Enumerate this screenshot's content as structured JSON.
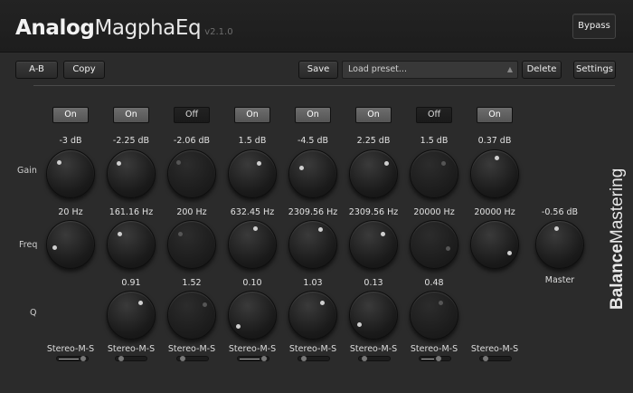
{
  "app": {
    "title_bold": "Analog",
    "title_light": "MagphaEq",
    "version": "v2.1.0",
    "bypass_label": "Bypass"
  },
  "toolbar": {
    "ab_label": "A-B",
    "copy_label": "Copy",
    "save_label": "Save",
    "preset_placeholder": "Load preset...",
    "delete_label": "Delete",
    "settings_label": "Settings"
  },
  "row_labels": {
    "gain": "Gain",
    "freq": "Freq",
    "q": "Q"
  },
  "bands": [
    {
      "state": "On",
      "gain": "-3 dB",
      "freq": "20 Hz",
      "q": "",
      "mode": "Stereo-M-S"
    },
    {
      "state": "On",
      "gain": "-2.25 dB",
      "freq": "161.16 Hz",
      "q": "0.91",
      "mode": "Stereo-M-S"
    },
    {
      "state": "Off",
      "gain": "-2.06 dB",
      "freq": "200 Hz",
      "q": "1.52",
      "mode": "Stereo-M-S"
    },
    {
      "state": "On",
      "gain": "1.5 dB",
      "freq": "632.45 Hz",
      "q": "0.10",
      "mode": "Stereo-M-S"
    },
    {
      "state": "On",
      "gain": "-4.5 dB",
      "freq": "2309.56 Hz",
      "q": "1.03",
      "mode": "Stereo-M-S"
    },
    {
      "state": "On",
      "gain": "2.25 dB",
      "freq": "2309.56 Hz",
      "q": "0.13",
      "mode": "Stereo-M-S"
    },
    {
      "state": "Off",
      "gain": "1.5 dB",
      "freq": "20000 Hz",
      "q": "0.48",
      "mode": "Stereo-M-S"
    },
    {
      "state": "On",
      "gain": "0.37 dB",
      "freq": "20000 Hz",
      "q": "",
      "mode": "Stereo-M-S"
    }
  ],
  "master": {
    "value": "-0.56 dB",
    "label": "Master"
  },
  "brand": {
    "bold": "Balance",
    "light": "Mastering"
  }
}
